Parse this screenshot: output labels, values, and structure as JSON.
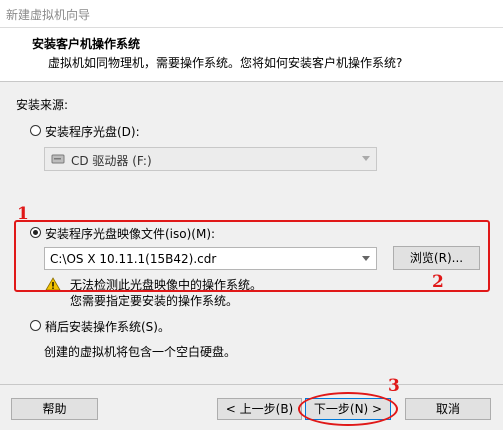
{
  "window": {
    "title": "新建虚拟机向导"
  },
  "header": {
    "title": "安装客户机操作系统",
    "subtitle": "虚拟机如同物理机，需要操作系统。您将如何安装客户机操作系统?"
  },
  "source_label": "安装来源:",
  "options": {
    "disc": {
      "label": "安装程序光盘(D):",
      "drive_value": "CD 驱动器 (F:)",
      "selected": false
    },
    "iso": {
      "label": "安装程序光盘映像文件(iso)(M):",
      "path_value": "C:\\OS X 10.11.1(15B42).cdr",
      "browse_label": "浏览(R)...",
      "selected": true
    },
    "later": {
      "label": "稍后安装操作系统(S)。",
      "description": "创建的虚拟机将包含一个空白硬盘。",
      "selected": false
    }
  },
  "warning": {
    "icon": "warning-icon",
    "line1": "无法检测此光盘映像中的操作系统。",
    "line2": "您需要指定要安装的操作系统。"
  },
  "buttons": {
    "help": "帮助",
    "back": "< 上一步(B)",
    "next": "下一步(N) >",
    "cancel": "取消"
  },
  "annotations": {
    "a1": "1",
    "a2": "2",
    "a3": "3"
  },
  "colors": {
    "annotation": "#e01818",
    "warning": "#f2c200"
  }
}
